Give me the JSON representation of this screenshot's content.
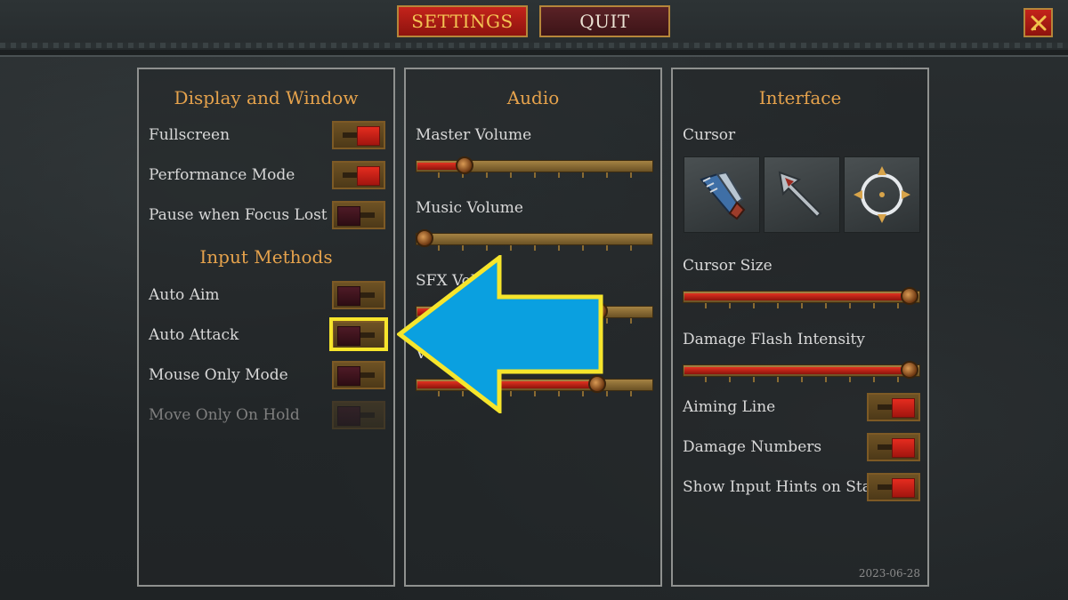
{
  "top_tabs": {
    "settings_label": "SETTINGS",
    "quit_label": "QUIT"
  },
  "panels": {
    "display": {
      "heading": "Display and Window",
      "options": [
        {
          "label": "Fullscreen",
          "state": "on"
        },
        {
          "label": "Performance Mode",
          "state": "on"
        },
        {
          "label": "Pause when Focus Lost",
          "state": "off"
        }
      ],
      "input_heading": "Input Methods",
      "input_options": [
        {
          "label": "Auto Aim",
          "state": "off"
        },
        {
          "label": "Auto Attack",
          "state": "off"
        },
        {
          "label": "Mouse Only Mode",
          "state": "off"
        },
        {
          "label": "Move Only On Hold",
          "state": "disabled"
        }
      ]
    },
    "audio": {
      "heading": "Audio",
      "sliders": [
        {
          "label": "Master Volume",
          "value": 0.21
        },
        {
          "label": "Music Volume",
          "value": 0.04
        },
        {
          "label": "SFX Vol",
          "value": 0.79
        },
        {
          "label": "V",
          "value": 0.78
        }
      ]
    },
    "interface": {
      "heading": "Interface",
      "cursor_label": "Cursor",
      "cursor_options": [
        "gauntlet-cursor-icon",
        "arrow-cursor-icon",
        "crosshair-cursor-icon"
      ],
      "cursor_size_label": "Cursor Size",
      "cursor_size_value": 1.0,
      "damage_flash_label": "Damage Flash Intensity",
      "damage_flash_value": 1.0,
      "toggles": [
        {
          "label": "Aiming Line",
          "state": "on"
        },
        {
          "label": "Damage Numbers",
          "state": "on"
        },
        {
          "label": "Show Input Hints on Start",
          "state": "on"
        }
      ],
      "date": "2023-06-28"
    }
  },
  "colors": {
    "accent_gold": "#e5a24c",
    "toggle_on": "#e52c1f",
    "highlight": "#f6e52c",
    "arrow": "#0aa0e0"
  }
}
